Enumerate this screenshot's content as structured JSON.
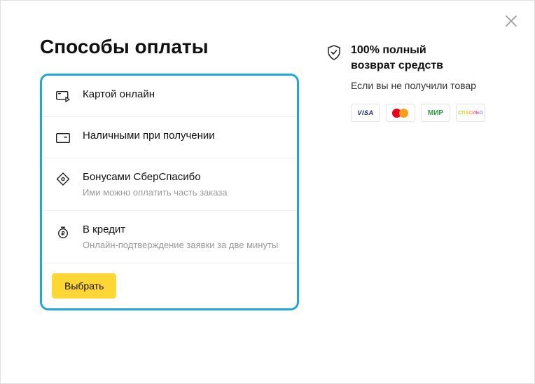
{
  "title": "Способы оплаты",
  "options": [
    {
      "label": "Картой онлайн",
      "sub": ""
    },
    {
      "label": "Наличными при получении",
      "sub": ""
    },
    {
      "label": "Бонусами СберСпасибо",
      "sub": "Ими можно оплатить часть заказа"
    },
    {
      "label": "В кредит",
      "sub": "Онлайн-подтверждение заявки за две минуты"
    }
  ],
  "select_button": "Выбрать",
  "guarantee": {
    "title_line1": "100% полный",
    "title_line2": "возврат средств",
    "sub": "Если вы не получили товар"
  },
  "badges": {
    "visa": "VISA",
    "mir": "МИР",
    "spasibo": "СПАСИБО"
  }
}
